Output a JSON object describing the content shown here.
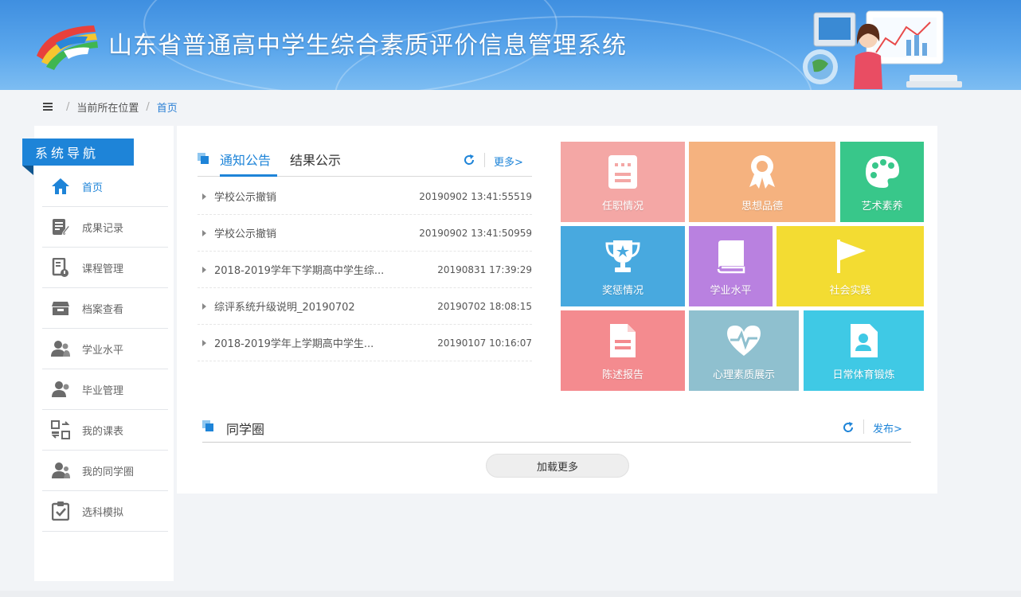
{
  "header": {
    "title": "山东省普通高中学生综合素质评价信息管理系统",
    "logo_icon": "rainbow-logo-icon"
  },
  "breadcrumb": {
    "menu_icon": "menu-icon",
    "location_label": "当前所在位置",
    "current": "首页"
  },
  "sidebar": {
    "heading": "系统导航",
    "items": [
      {
        "label": "首页",
        "icon": "home-icon",
        "active": true
      },
      {
        "label": "成果记录",
        "icon": "edit-note-icon"
      },
      {
        "label": "课程管理",
        "icon": "course-icon"
      },
      {
        "label": "档案查看",
        "icon": "archive-box-icon"
      },
      {
        "label": "学业水平",
        "icon": "users-icon"
      },
      {
        "label": "毕业管理",
        "icon": "graduate-icon"
      },
      {
        "label": "我的课表",
        "icon": "schedule-icon"
      },
      {
        "label": "我的同学圈",
        "icon": "classmates-icon"
      },
      {
        "label": "选科模拟",
        "icon": "clipboard-check-icon"
      }
    ]
  },
  "notices": {
    "tabs": [
      {
        "label": "通知公告",
        "active": true
      },
      {
        "label": "结果公示",
        "active": false
      }
    ],
    "more_label": "更多>",
    "items": [
      {
        "title": "学校公示撤销",
        "time": "20190902 13:41:55519"
      },
      {
        "title": "学校公示撤销",
        "time": "20190902 13:41:50959"
      },
      {
        "title": "2018-2019学年下学期高中学生综...",
        "time": "20190831 17:39:29"
      },
      {
        "title": "综评系统升级说明_20190702",
        "time": "20190702 18:08:15"
      },
      {
        "title": "2018-2019学年上学期高中学生...",
        "time": "20190107 10:16:07"
      }
    ]
  },
  "tiles": [
    {
      "label": "任职情况",
      "icon": "document-icon",
      "color": "#f4a7a5"
    },
    {
      "label": "思想品德",
      "icon": "medal-icon",
      "color": "#f5b27f"
    },
    {
      "label": "艺术素养",
      "icon": "palette-icon",
      "color": "#38c78a"
    },
    {
      "label": "奖惩情况",
      "icon": "trophy-icon",
      "color": "#48a9df"
    },
    {
      "label": "学业水平",
      "icon": "book-icon",
      "color": "#b981e0"
    },
    {
      "label": "社会实践",
      "icon": "flag-icon",
      "color": "#f3dc32"
    },
    {
      "label": "陈述报告",
      "icon": "report-icon",
      "color": "#f48b8f"
    },
    {
      "label": "心理素质展示",
      "icon": "heart-pulse-icon",
      "color": "#8fc0cf"
    },
    {
      "label": "日常体育锻炼",
      "icon": "id-card-icon",
      "color": "#3fc9e5"
    }
  ],
  "classmates": {
    "title": "同学圈",
    "publish_label": "发布>",
    "load_more_label": "加载更多"
  },
  "colors": {
    "accent": "#1e84d8",
    "header_top": "#3f8fe0",
    "header_bottom": "#7dbdf2"
  }
}
